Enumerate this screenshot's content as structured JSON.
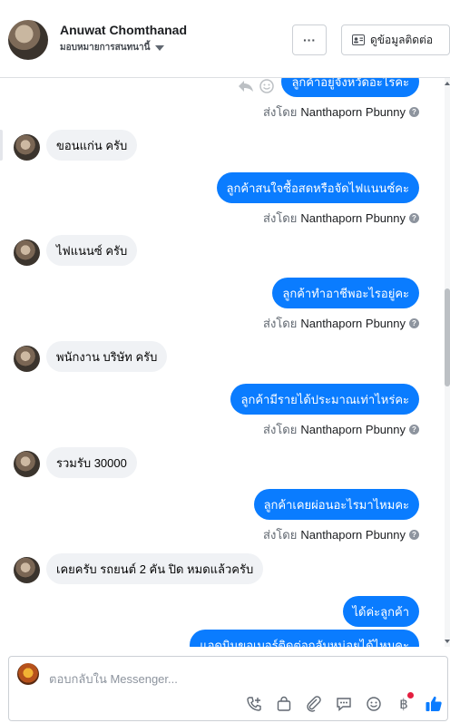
{
  "header": {
    "contact_name": "Anuwat Chomthanad",
    "assign_label": "มอบหมายการสนทนานี้",
    "more_label": "···",
    "view_contact_label": "ดูข้อมูลติดต่อ"
  },
  "messages": [
    {
      "dir": "out",
      "text": "ลูกค้าอยู่จังหวัดอะไรคะ",
      "sender_prefix": "ส่งโดย",
      "sender": "Nanthaporn Pbunny"
    },
    {
      "dir": "in",
      "text": "ขอนแก่น ครับ"
    },
    {
      "dir": "out",
      "text": "ลูกค้าสนใจซื้อสดหรือจัดไฟแนนซ์คะ",
      "sender_prefix": "ส่งโดย",
      "sender": "Nanthaporn Pbunny"
    },
    {
      "dir": "in",
      "text": "ไฟแนนซ์ ครับ"
    },
    {
      "dir": "out",
      "text": "ลูกค้าทำอาชีพอะไรอยู่คะ",
      "sender_prefix": "ส่งโดย",
      "sender": "Nanthaporn Pbunny"
    },
    {
      "dir": "in",
      "text": "พนักงาน บริษัท ครับ"
    },
    {
      "dir": "out",
      "text": "ลูกค้ามีรายได้ประมาณเท่าไหร่คะ",
      "sender_prefix": "ส่งโดย",
      "sender": "Nanthaporn Pbunny"
    },
    {
      "dir": "in",
      "text": "รวมรับ 30000"
    },
    {
      "dir": "out",
      "text": "ลูกค้าเคยผ่อนอะไรมาไหมคะ",
      "sender_prefix": "ส่งโดย",
      "sender": "Nanthaporn Pbunny"
    },
    {
      "dir": "in",
      "text": "เคยครับ รถยนต์ 2 คัน ปิด หมดแล้วครับ"
    },
    {
      "dir": "out",
      "text": "ได้ค่ะลูกค้า"
    },
    {
      "dir": "out",
      "text": "แอดมินขอเบอร์ติดต่อกลับหน่อยได้ไหมคะ"
    }
  ],
  "composer": {
    "placeholder": "ตอบกลับใน Messenger..."
  },
  "icons": {
    "reply": "reply-icon",
    "emoji": "emoji-icon",
    "info": "info-icon",
    "toolbar": [
      "phone-add-icon",
      "bag-icon",
      "paperclip-icon",
      "chat-icon",
      "smiley-icon",
      "baht-icon",
      "thumbs-up-icon"
    ]
  },
  "colors": {
    "outgoing_bubble": "#0a7cff",
    "incoming_bubble": "#f0f2f5",
    "like": "#0a7cff",
    "notification_dot": "#e41e3f"
  }
}
